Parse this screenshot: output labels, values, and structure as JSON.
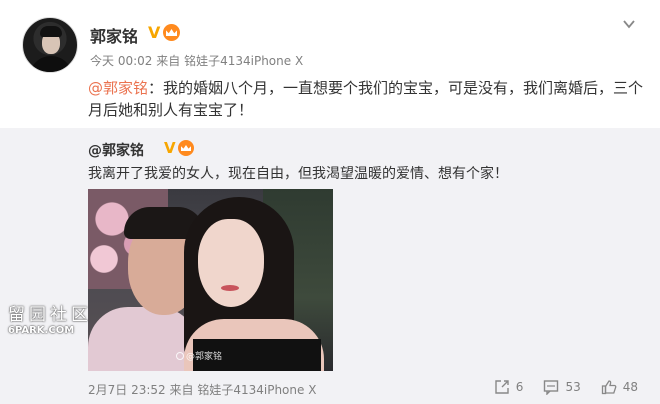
{
  "post": {
    "username": "郭家铭",
    "verified_badge": "V",
    "time": "今天 00:02",
    "source_prefix": "来自",
    "source": "铭娃子4134iPhone X",
    "mention": "@郭家铭",
    "text": "：我的婚姻八个月，一直想要个我们的宝宝，可是没有，我们离婚后，三个月后她和别人有宝宝了！"
  },
  "original": {
    "username": "@郭家铭",
    "verified_badge": "V",
    "text": "我离开了我爱的女人，现在自由，但我渴望温暖的爱情、想有个家！",
    "photo_watermark": "@郭家铭",
    "time": "2月7日 23:52",
    "source_prefix": "来自",
    "source": "铭娃子4134iPhone X",
    "repost_count": "6",
    "comment_count": "53",
    "like_count": "48"
  },
  "site_watermark": {
    "cn": "留园社区",
    "en": "6PARK.COM"
  },
  "colors": {
    "mention": "#eb7350",
    "verified": "#f7a600",
    "meta": "#808080",
    "repost_bg": "#f2f2f5"
  },
  "icons": [
    "chevron-down-icon",
    "crown-icon",
    "repost-icon",
    "comment-icon",
    "like-icon",
    "weibo-icon"
  ]
}
